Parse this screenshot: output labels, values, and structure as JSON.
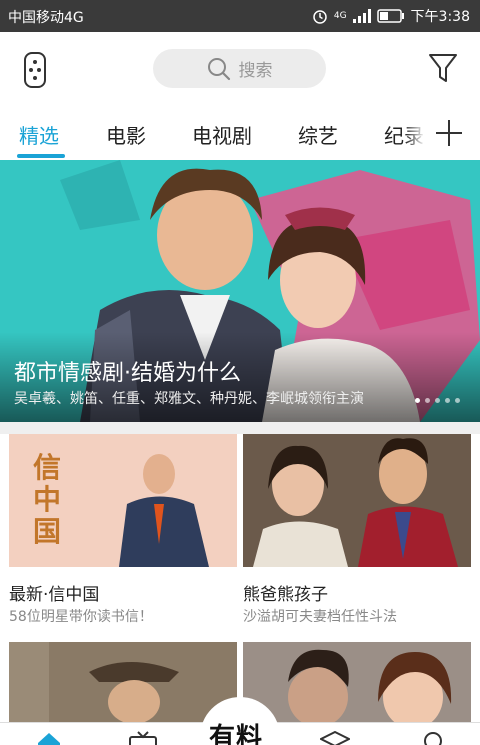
{
  "status_bar": {
    "carrier": "中国移动4G",
    "network": "4G",
    "time": "下午3:38"
  },
  "header": {
    "search_placeholder": "搜索"
  },
  "tabs": [
    {
      "label": "精选",
      "active": true
    },
    {
      "label": "电影",
      "active": false
    },
    {
      "label": "电视剧",
      "active": false
    },
    {
      "label": "综艺",
      "active": false
    },
    {
      "label": "纪录片",
      "active": false
    }
  ],
  "banner": {
    "title": "都市情感剧·结婚为什么",
    "subtitle": "吴卓羲、姚笛、任重、郑雅文、种丹妮、李岷城领衔主演",
    "page_count": 5,
    "active_page": 0
  },
  "cards": [
    {
      "title": "最新·信中国",
      "subtitle": "58位明星带你读书信！",
      "poster_text": "信中国"
    },
    {
      "title": "熊爸熊孩子",
      "subtitle": "沙溢胡可夫妻档任性斗法"
    },
    {
      "title": "",
      "subtitle": ""
    },
    {
      "title": "",
      "subtitle": ""
    }
  ],
  "bottom_nav": {
    "center_label": "有料"
  },
  "colors": {
    "accent": "#1aa3d6",
    "status_bar_bg": "#3a3a3a",
    "banner_bg": "#35c6c2"
  }
}
